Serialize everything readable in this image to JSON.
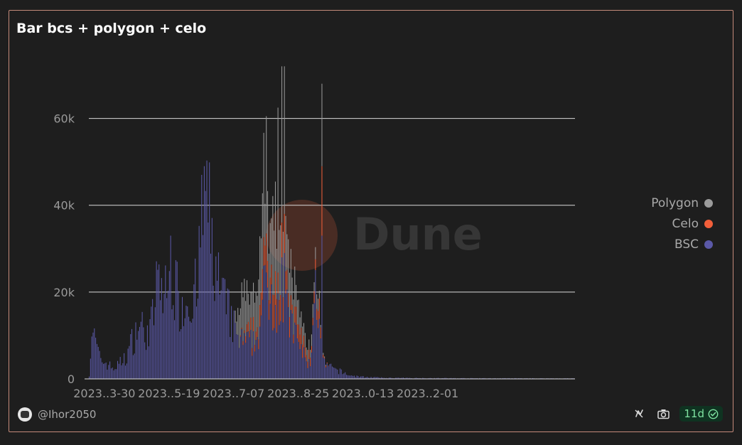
{
  "title": "Bar bcs + polygon + celo",
  "author": "@Ihor2050",
  "freshness": "11d",
  "watermark": "Dune",
  "colors": {
    "bsc": "#5b59a8",
    "celo": "#f25f3a",
    "polygon": "#9b9b9b",
    "grid": "#d9d9d9",
    "axis": "#9a9a9a"
  },
  "icons": {
    "avatar": "avatar-icon",
    "refresh": "refresh-icon",
    "camera": "camera-icon",
    "check": "check-circle-icon"
  },
  "chart_data": {
    "type": "bar",
    "stacked": true,
    "x_range": [
      "2023-03-18",
      "2024-03-27"
    ],
    "x_ticks": [
      "2023..3-30",
      "2023..5-19",
      "2023..7-07",
      "2023..8-25",
      "2023..0-13",
      "2023..2-01"
    ],
    "y_ticks": [
      "0",
      "20k",
      "40k",
      "60k"
    ],
    "ylim": [
      0,
      75000
    ],
    "grid": true,
    "legend_position": "right",
    "series": [
      {
        "key": "polygon",
        "name": "Polygon"
      },
      {
        "key": "celo",
        "name": "Celo"
      },
      {
        "key": "bsc",
        "name": "BSC"
      }
    ],
    "keypoints": {
      "bsc": [
        [
          "2023-03-18",
          1000
        ],
        [
          "2023-03-20",
          12000
        ],
        [
          "2023-03-26",
          5000
        ],
        [
          "2023-03-30",
          4000
        ],
        [
          "2023-04-06",
          2500
        ],
        [
          "2023-04-15",
          5000
        ],
        [
          "2023-04-25",
          13000
        ],
        [
          "2023-05-02",
          11000
        ],
        [
          "2023-05-06",
          14000
        ],
        [
          "2023-05-10",
          24000
        ],
        [
          "2023-05-16",
          20000
        ],
        [
          "2023-05-22",
          23000
        ],
        [
          "2023-05-28",
          18000
        ],
        [
          "2023-06-05",
          20000
        ],
        [
          "2023-06-10",
          21000
        ],
        [
          "2023-06-13",
          40000
        ],
        [
          "2023-06-18",
          40000
        ],
        [
          "2023-06-22",
          30000
        ],
        [
          "2023-06-28",
          20000
        ],
        [
          "2023-07-05",
          15000
        ],
        [
          "2023-07-10",
          10000
        ],
        [
          "2023-07-14",
          9000
        ],
        [
          "2023-07-20",
          8500
        ],
        [
          "2023-07-25",
          9000
        ],
        [
          "2023-07-28",
          13000
        ],
        [
          "2023-08-01",
          22000
        ],
        [
          "2023-08-04",
          21000
        ],
        [
          "2023-08-08",
          20000
        ],
        [
          "2023-08-12",
          18000
        ],
        [
          "2023-08-16",
          17000
        ],
        [
          "2023-08-20",
          14000
        ],
        [
          "2023-08-25",
          10000
        ],
        [
          "2023-08-28",
          8000
        ],
        [
          "2023-09-02",
          4000
        ],
        [
          "2023-09-05",
          3500
        ],
        [
          "2023-09-08",
          20000
        ],
        [
          "2023-09-10",
          21000
        ],
        [
          "2023-09-13",
          7500
        ],
        [
          "2023-09-16",
          3500
        ],
        [
          "2023-09-22",
          2500
        ],
        [
          "2023-09-28",
          1800
        ],
        [
          "2023-10-06",
          800
        ],
        [
          "2023-10-15",
          500
        ],
        [
          "2023-11-01",
          250
        ],
        [
          "2023-12-31",
          150
        ],
        [
          "2024-03-27",
          120
        ]
      ],
      "celo": [
        [
          "2023-03-18",
          0
        ],
        [
          "2023-07-12",
          0
        ],
        [
          "2023-07-20",
          2000
        ],
        [
          "2023-07-26",
          3000
        ],
        [
          "2023-08-01",
          6500
        ],
        [
          "2023-08-04",
          7500
        ],
        [
          "2023-08-08",
          6500
        ],
        [
          "2023-08-12",
          5000
        ],
        [
          "2023-08-16",
          4500
        ],
        [
          "2023-08-22",
          3500
        ],
        [
          "2023-08-28",
          3500
        ],
        [
          "2023-09-03",
          1800
        ],
        [
          "2023-09-08",
          3000
        ],
        [
          "2023-09-12",
          4000
        ],
        [
          "2023-09-14",
          600
        ],
        [
          "2023-09-20",
          0
        ],
        [
          "2024-03-27",
          0
        ]
      ],
      "polygon": [
        [
          "2023-03-18",
          0
        ],
        [
          "2023-07-08",
          0
        ],
        [
          "2023-07-10",
          5000
        ],
        [
          "2023-07-14",
          9500
        ],
        [
          "2023-07-18",
          9000
        ],
        [
          "2023-07-24",
          10500
        ],
        [
          "2023-07-28",
          14000
        ],
        [
          "2023-08-01",
          16000
        ],
        [
          "2023-08-04",
          17500
        ],
        [
          "2023-08-08",
          18500
        ],
        [
          "2023-08-12",
          14000
        ],
        [
          "2023-08-16",
          11500
        ],
        [
          "2023-08-20",
          9500
        ],
        [
          "2023-08-26",
          6500
        ],
        [
          "2023-09-02",
          2500
        ],
        [
          "2023-09-07",
          3000
        ],
        [
          "2023-09-10",
          3800
        ],
        [
          "2023-09-13",
          900
        ],
        [
          "2023-09-18",
          0
        ],
        [
          "2024-03-27",
          0
        ]
      ]
    },
    "spikes": [
      {
        "date": "2023-06-13",
        "bsc": 47000
      },
      {
        "date": "2023-06-15",
        "bsc": 49000
      },
      {
        "date": "2023-05-20",
        "bsc": 33000
      },
      {
        "date": "2023-07-31",
        "polygon": 24000
      },
      {
        "date": "2023-08-02",
        "celo": 9000,
        "polygon": 27000
      },
      {
        "date": "2023-08-11",
        "polygon": 38000
      },
      {
        "date": "2023-08-14",
        "bsc": 28000,
        "celo": 8000,
        "polygon": 36000
      },
      {
        "date": "2023-08-16",
        "bsc": 29000,
        "celo": 9000,
        "polygon": 34000
      },
      {
        "date": "2023-09-14",
        "bsc": 33000,
        "celo": 16000,
        "polygon": 19000
      }
    ]
  }
}
